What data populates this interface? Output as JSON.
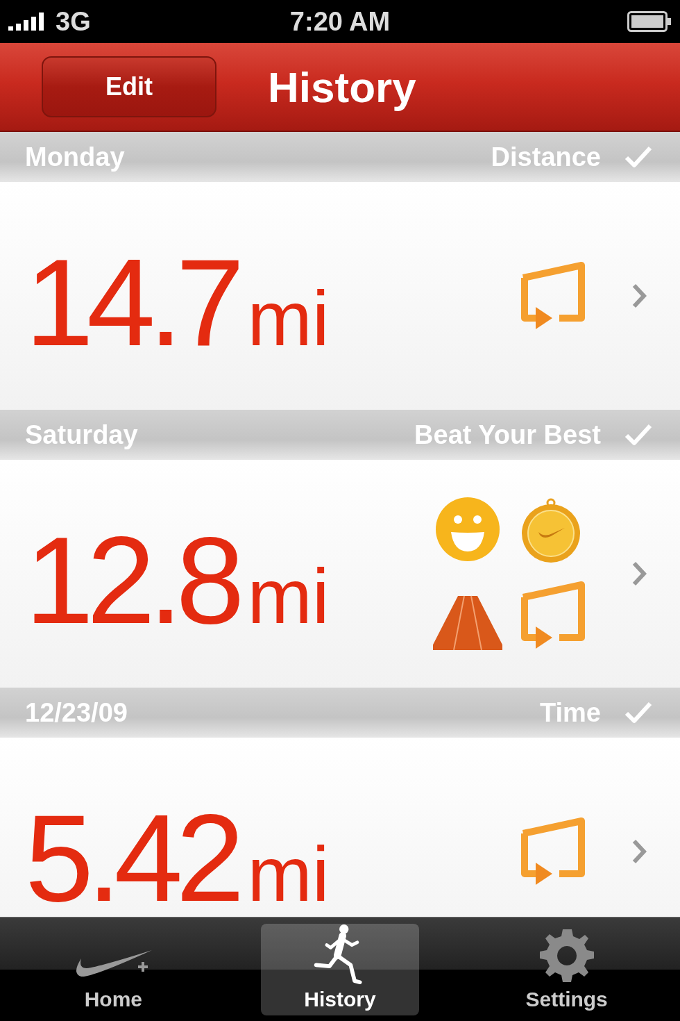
{
  "status_bar": {
    "carrier": "3G",
    "time": "7:20 AM"
  },
  "nav": {
    "edit_button": "Edit",
    "title": "History"
  },
  "runs": [
    {
      "date": "Monday",
      "goal": "Distance",
      "completed": true,
      "value": "14.7",
      "unit": "mi",
      "badges": [
        {
          "kind": "replay"
        }
      ]
    },
    {
      "date": "Saturday",
      "goal": "Beat Your Best",
      "completed": true,
      "value": "12.8",
      "unit": "mi",
      "badges": [
        {
          "kind": "smiley"
        },
        {
          "kind": "medal"
        },
        {
          "kind": "road"
        },
        {
          "kind": "replay"
        }
      ]
    },
    {
      "date": "12/23/09",
      "goal": "Time",
      "completed": true,
      "value": "5.42",
      "unit": "mi",
      "badges": [
        {
          "kind": "replay"
        }
      ]
    }
  ],
  "tabs": [
    {
      "label": "Home",
      "kind": "swoosh",
      "selected": false
    },
    {
      "label": "History",
      "kind": "runner",
      "selected": true
    },
    {
      "label": "Settings",
      "kind": "gear",
      "selected": false
    }
  ]
}
